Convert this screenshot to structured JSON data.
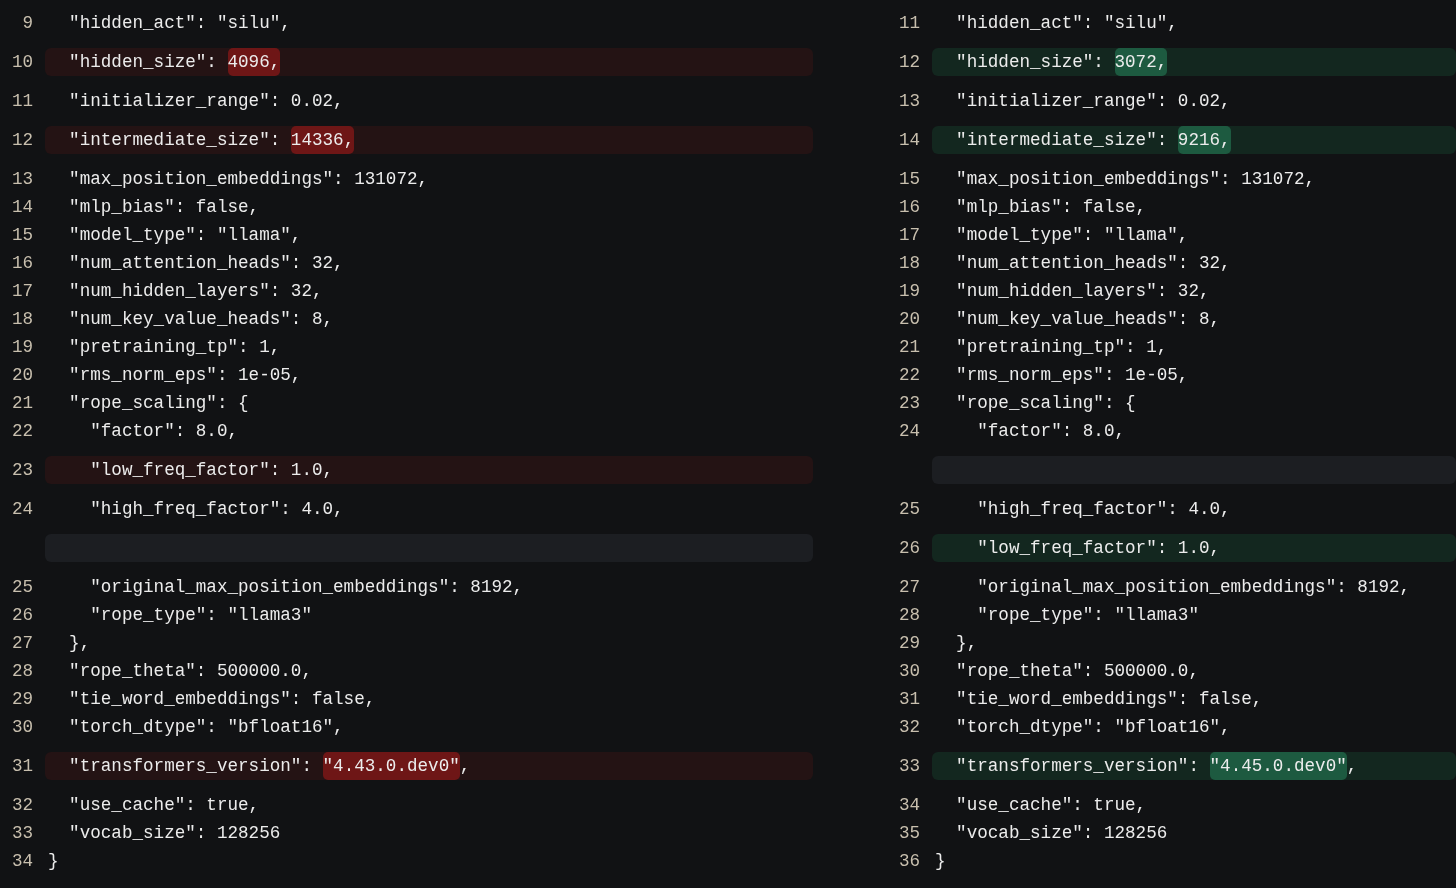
{
  "left": {
    "lines": [
      {
        "kind": "context",
        "number": "9",
        "text": "  \"hidden_act\": \"silu\","
      },
      {
        "kind": "deleted",
        "number": "10",
        "parts": [
          {
            "text": "  \"hidden_size\": ",
            "highlight": false
          },
          {
            "text": "4096,",
            "highlight": true
          }
        ]
      },
      {
        "kind": "context",
        "number": "11",
        "text": "  \"initializer_range\": 0.02,"
      },
      {
        "kind": "deleted",
        "number": "12",
        "parts": [
          {
            "text": "  \"intermediate_size\": ",
            "highlight": false
          },
          {
            "text": "14336,",
            "highlight": true
          }
        ]
      },
      {
        "kind": "context",
        "number": "13",
        "text": "  \"max_position_embeddings\": 131072,"
      },
      {
        "kind": "context",
        "number": "14",
        "text": "  \"mlp_bias\": false,"
      },
      {
        "kind": "context",
        "number": "15",
        "text": "  \"model_type\": \"llama\","
      },
      {
        "kind": "context",
        "number": "16",
        "text": "  \"num_attention_heads\": 32,"
      },
      {
        "kind": "context",
        "number": "17",
        "text": "  \"num_hidden_layers\": 32,"
      },
      {
        "kind": "context",
        "number": "18",
        "text": "  \"num_key_value_heads\": 8,"
      },
      {
        "kind": "context",
        "number": "19",
        "text": "  \"pretraining_tp\": 1,"
      },
      {
        "kind": "context",
        "number": "20",
        "text": "  \"rms_norm_eps\": 1e-05,"
      },
      {
        "kind": "context",
        "number": "21",
        "text": "  \"rope_scaling\": {"
      },
      {
        "kind": "context",
        "number": "22",
        "text": "    \"factor\": 8.0,"
      },
      {
        "kind": "deleted",
        "number": "23",
        "parts": [
          {
            "text": "    \"low_freq_factor\": 1.0,",
            "highlight": false
          }
        ]
      },
      {
        "kind": "context",
        "number": "24",
        "text": "    \"high_freq_factor\": 4.0,"
      },
      {
        "kind": "empty"
      },
      {
        "kind": "context",
        "number": "25",
        "text": "    \"original_max_position_embeddings\": 8192,"
      },
      {
        "kind": "context",
        "number": "26",
        "text": "    \"rope_type\": \"llama3\""
      },
      {
        "kind": "context",
        "number": "27",
        "text": "  },"
      },
      {
        "kind": "context",
        "number": "28",
        "text": "  \"rope_theta\": 500000.0,"
      },
      {
        "kind": "context",
        "number": "29",
        "text": "  \"tie_word_embeddings\": false,"
      },
      {
        "kind": "context",
        "number": "30",
        "text": "  \"torch_dtype\": \"bfloat16\","
      },
      {
        "kind": "deleted",
        "number": "31",
        "parts": [
          {
            "text": "  \"transformers_version\": ",
            "highlight": false
          },
          {
            "text": "\"4.43.0.dev0\"",
            "highlight": true
          },
          {
            "text": ",",
            "highlight": false
          }
        ]
      },
      {
        "kind": "context",
        "number": "32",
        "text": "  \"use_cache\": true,"
      },
      {
        "kind": "context",
        "number": "33",
        "text": "  \"vocab_size\": 128256"
      },
      {
        "kind": "context",
        "number": "34",
        "text": "}"
      }
    ]
  },
  "right": {
    "lines": [
      {
        "kind": "context",
        "number": "11",
        "text": "  \"hidden_act\": \"silu\","
      },
      {
        "kind": "added",
        "number": "12",
        "parts": [
          {
            "text": "  \"hidden_size\": ",
            "highlight": false
          },
          {
            "text": "3072,",
            "highlight": true
          }
        ]
      },
      {
        "kind": "context",
        "number": "13",
        "text": "  \"initializer_range\": 0.02,"
      },
      {
        "kind": "added",
        "number": "14",
        "parts": [
          {
            "text": "  \"intermediate_size\": ",
            "highlight": false
          },
          {
            "text": "9216,",
            "highlight": true
          }
        ]
      },
      {
        "kind": "context",
        "number": "15",
        "text": "  \"max_position_embeddings\": 131072,"
      },
      {
        "kind": "context",
        "number": "16",
        "text": "  \"mlp_bias\": false,"
      },
      {
        "kind": "context",
        "number": "17",
        "text": "  \"model_type\": \"llama\","
      },
      {
        "kind": "context",
        "number": "18",
        "text": "  \"num_attention_heads\": 32,"
      },
      {
        "kind": "context",
        "number": "19",
        "text": "  \"num_hidden_layers\": 32,"
      },
      {
        "kind": "context",
        "number": "20",
        "text": "  \"num_key_value_heads\": 8,"
      },
      {
        "kind": "context",
        "number": "21",
        "text": "  \"pretraining_tp\": 1,"
      },
      {
        "kind": "context",
        "number": "22",
        "text": "  \"rms_norm_eps\": 1e-05,"
      },
      {
        "kind": "context",
        "number": "23",
        "text": "  \"rope_scaling\": {"
      },
      {
        "kind": "context",
        "number": "24",
        "text": "    \"factor\": 8.0,"
      },
      {
        "kind": "empty"
      },
      {
        "kind": "context",
        "number": "25",
        "text": "    \"high_freq_factor\": 4.0,"
      },
      {
        "kind": "added",
        "number": "26",
        "parts": [
          {
            "text": "    \"low_freq_factor\": 1.0,",
            "highlight": false
          }
        ]
      },
      {
        "kind": "context",
        "number": "27",
        "text": "    \"original_max_position_embeddings\": 8192,"
      },
      {
        "kind": "context",
        "number": "28",
        "text": "    \"rope_type\": \"llama3\""
      },
      {
        "kind": "context",
        "number": "29",
        "text": "  },"
      },
      {
        "kind": "context",
        "number": "30",
        "text": "  \"rope_theta\": 500000.0,"
      },
      {
        "kind": "context",
        "number": "31",
        "text": "  \"tie_word_embeddings\": false,"
      },
      {
        "kind": "context",
        "number": "32",
        "text": "  \"torch_dtype\": \"bfloat16\","
      },
      {
        "kind": "added",
        "number": "33",
        "parts": [
          {
            "text": "  \"transformers_version\": ",
            "highlight": false
          },
          {
            "text": "\"4.45.0.dev0\"",
            "highlight": true
          },
          {
            "text": ",",
            "highlight": false
          }
        ]
      },
      {
        "kind": "context",
        "number": "34",
        "text": "  \"use_cache\": true,"
      },
      {
        "kind": "context",
        "number": "35",
        "text": "  \"vocab_size\": 128256"
      },
      {
        "kind": "context",
        "number": "36",
        "text": "}"
      }
    ]
  }
}
